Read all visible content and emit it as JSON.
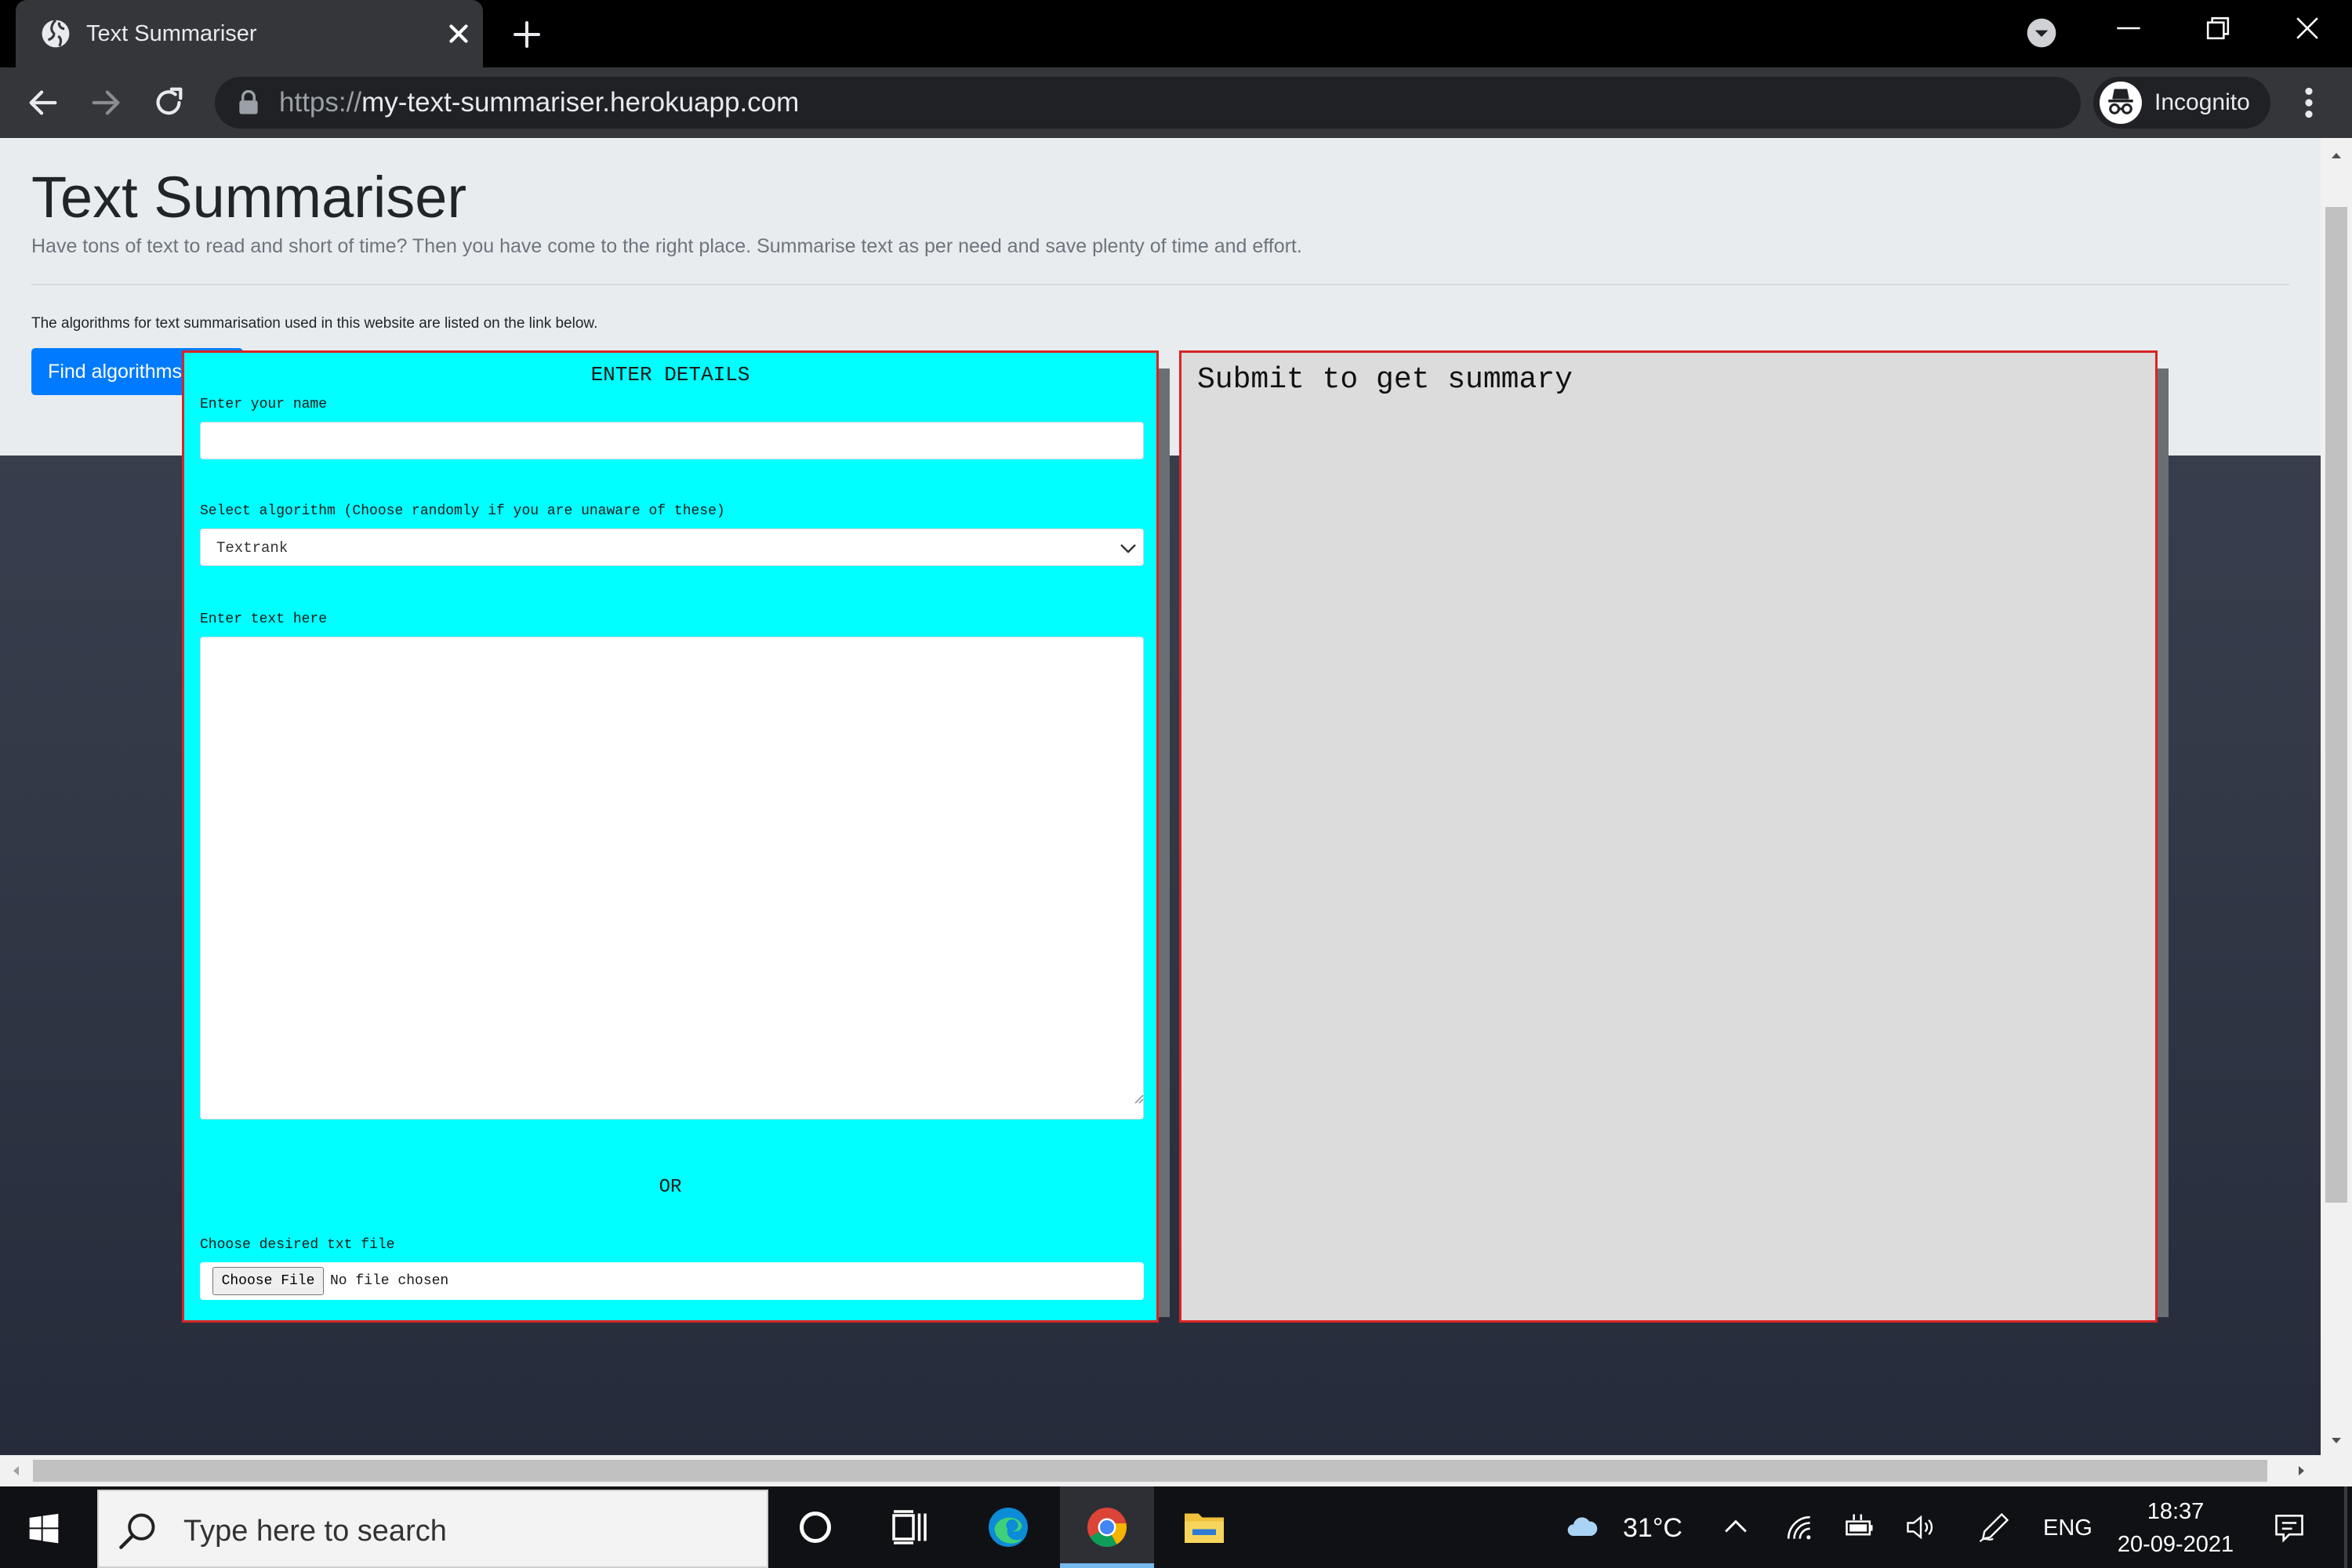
{
  "browser": {
    "tab_title": "Text Summariser",
    "url_scheme": "https://",
    "url_host": "my-text-summariser.herokuapp.com",
    "profile_label": "Incognito"
  },
  "page": {
    "title": "Text Summariser",
    "lead": "Have tons of text to read and short of time? Then you have come to the right place. Summarise text as per need and save plenty of time and effort.",
    "note": "The algorithms for text summarisation used in this website are listed on the link below.",
    "algorithms_button": "Find algorithms here"
  },
  "form": {
    "heading": "ENTER DETAILS",
    "name_label": "Enter your name",
    "name_value": "",
    "algorithm_label": "Select algorithm (Choose randomly if you are unaware of these)",
    "algorithm_selected": "Textrank",
    "text_label": "Enter text here",
    "text_value": "",
    "or_label": "OR",
    "file_label": "Choose desired txt file",
    "file_button": "Choose File",
    "file_status": "No file chosen"
  },
  "summary": {
    "placeholder": "Submit to get summary"
  },
  "taskbar": {
    "search_placeholder": "Type here to search",
    "weather_temp": "31°C",
    "language": "ENG",
    "time": "18:37",
    "date": "20-09-2021"
  },
  "colors": {
    "form_bg": "#00ffff",
    "panel_border": "#d92424",
    "summary_bg": "#dcdcdc",
    "primary_button": "#007bff",
    "jumbotron_bg": "#e9ecef"
  }
}
